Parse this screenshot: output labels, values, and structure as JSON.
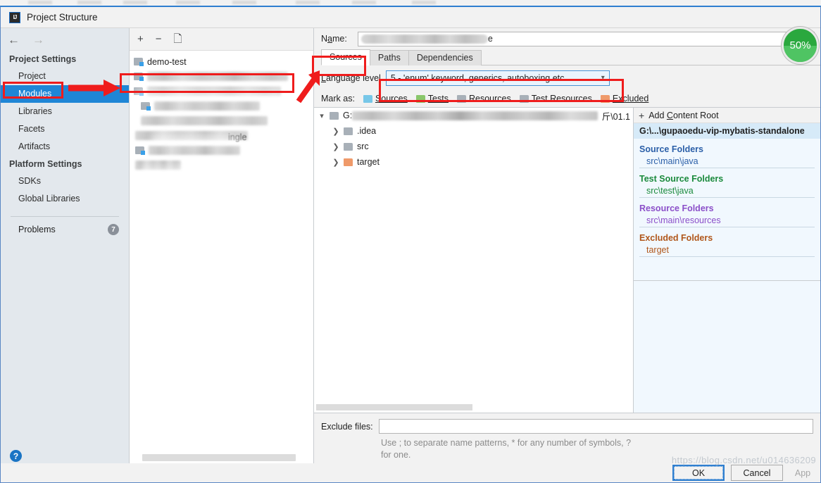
{
  "window": {
    "title": "Project Structure",
    "icon": "intellij-idea-icon"
  },
  "nav": {
    "back_icon": "arrow-left-icon",
    "forward_icon": "arrow-right-icon"
  },
  "sidebar": {
    "groups": [
      {
        "label": "Project Settings",
        "items": [
          {
            "label": "Project",
            "selected": false
          },
          {
            "label": "Modules",
            "selected": true
          },
          {
            "label": "Libraries",
            "selected": false
          },
          {
            "label": "Facets",
            "selected": false
          },
          {
            "label": "Artifacts",
            "selected": false
          }
        ]
      },
      {
        "label": "Platform Settings",
        "items": [
          {
            "label": "SDKs",
            "selected": false
          },
          {
            "label": "Global Libraries",
            "selected": false
          }
        ]
      }
    ],
    "problems": {
      "label": "Problems",
      "count": "7"
    },
    "help_label": "?"
  },
  "modules_panel": {
    "toolbar": {
      "add": "+",
      "remove": "−",
      "copy_icon": "copy-icon"
    },
    "items": [
      {
        "label": "demo-test",
        "redacted": false
      },
      {
        "label": "",
        "redacted": true
      },
      {
        "label": "",
        "redacted": true
      },
      {
        "label": "",
        "redacted": true
      },
      {
        "label": "",
        "redacted": true
      },
      {
        "label": "",
        "redacted": true
      },
      {
        "label": "",
        "redacted": true
      },
      {
        "label": "",
        "redacted": true
      }
    ],
    "partial_text": "ingle"
  },
  "editor": {
    "name_label": "Name:",
    "name_value": "e",
    "tabs": [
      {
        "label": "Sources",
        "active": true
      },
      {
        "label": "Paths",
        "active": false
      },
      {
        "label": "Dependencies",
        "active": false
      }
    ],
    "language_level_label": "Language level",
    "language_level_value": "5 - 'enum' keyword, generics, autoboxing etc.",
    "mark_as_label": "Mark as:",
    "mark_as": [
      {
        "label": "Sources",
        "icon": "sources-folder-icon",
        "color": "#77c7e8"
      },
      {
        "label": "Tests",
        "icon": "tests-folder-icon",
        "color": "#89c76b"
      },
      {
        "label": "Resources",
        "icon": "resources-folder-icon",
        "color": "#a8b0b8"
      },
      {
        "label": "Test Resources",
        "icon": "test-resources-folder-icon",
        "color": "#a8b0b8"
      },
      {
        "label": "Excluded",
        "icon": "excluded-folder-icon",
        "color": "#ef9a6a"
      }
    ],
    "tree": {
      "root_prefix": "G:",
      "root_suffix": "斤\\01.1",
      "children": [
        {
          "label": ".idea",
          "kind": "plain"
        },
        {
          "label": "src",
          "kind": "plain"
        },
        {
          "label": "target",
          "kind": "excluded"
        }
      ]
    },
    "exclude_label": "Exclude files:",
    "exclude_value": "",
    "exclude_hint": "Use ; to separate name patterns, * for any number of symbols, ? for one."
  },
  "content_roots": {
    "add_label": "Add Content Root",
    "root_path": "G:\\...\\gupaoedu-vip-mybatis-standalone",
    "sections": [
      {
        "title": "Source Folders",
        "color": "#2b5fa8",
        "items": [
          "src\\main\\java"
        ]
      },
      {
        "title": "Test Source Folders",
        "color": "#1a8a3c",
        "items": [
          "src\\test\\java"
        ]
      },
      {
        "title": "Resource Folders",
        "color": "#8b4fc9",
        "items": [
          "src\\main\\resources"
        ]
      },
      {
        "title": "Excluded Folders",
        "color": "#b0561a",
        "items": [
          "target"
        ]
      }
    ]
  },
  "footer": {
    "ok": "OK",
    "cancel": "Cancel",
    "apply": "App",
    "watermark": "https://blog.csdn.net/u014636209"
  },
  "badge": {
    "percent": "50%"
  }
}
